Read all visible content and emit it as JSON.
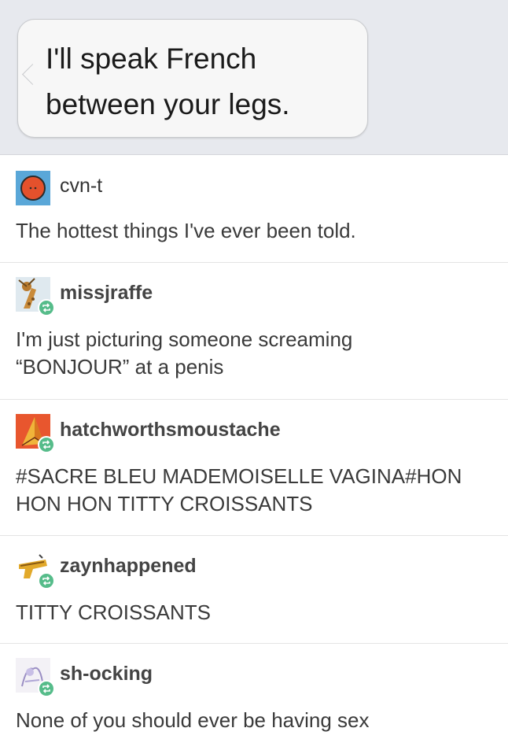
{
  "message": {
    "line1": "I'll speak French",
    "line2": "between your legs."
  },
  "colors": {
    "header_bg": "#e7e9ee",
    "reblog_badge": "#56bc8a",
    "divider": "#e4e4e4"
  },
  "posts": [
    {
      "username": "cvn-t",
      "text": "The hottest things I've ever been told.",
      "avatar_icon": "orange-circle-avatar",
      "reblog": false
    },
    {
      "username": "missjraffe",
      "text_lines": [
        "I'm just picturing someone screaming",
        "“BONJOUR” at a penis"
      ],
      "avatar_icon": "giraffe-avatar",
      "reblog": true
    },
    {
      "username": "hatchworthsmoustache",
      "text_lines": [
        "#SACRE BLEU MADEMOISELLE VAGINA#HON",
        "HON HON TITTY CROISSANTS"
      ],
      "avatar_icon": "triangle-avatar",
      "reblog": true
    },
    {
      "username": "zaynhappened",
      "text": "TITTY CROISSANTS",
      "avatar_icon": "toy-gun-avatar",
      "reblog": true
    },
    {
      "username": "sh-ocking",
      "text": "None of you should ever be having sex",
      "avatar_icon": "sketch-avatar",
      "reblog": true
    }
  ]
}
